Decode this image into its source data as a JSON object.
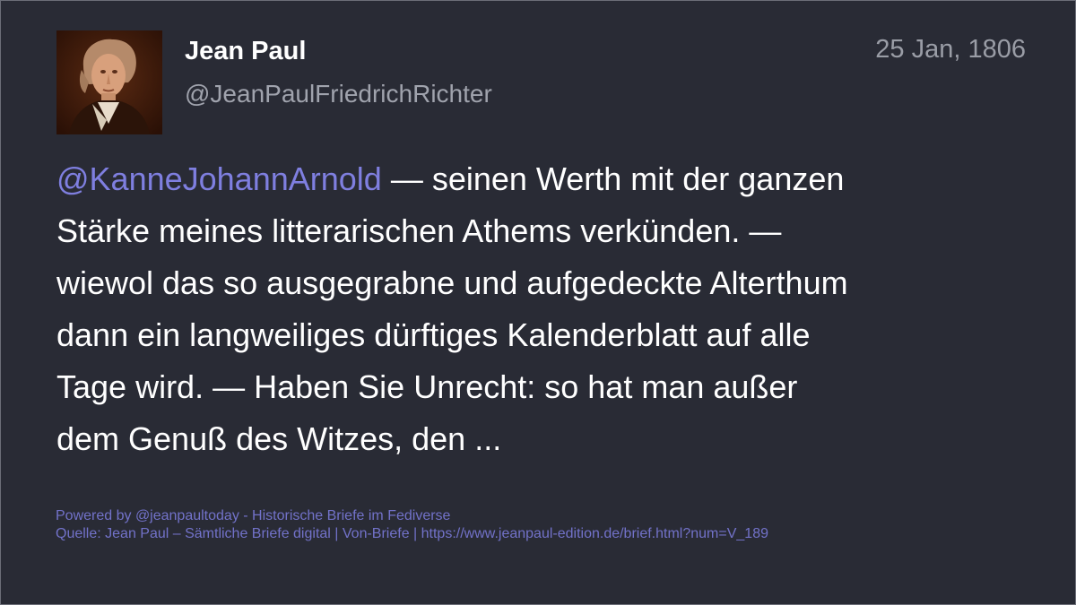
{
  "post": {
    "author_name": "Jean Paul",
    "author_handle": "@JeanPaulFriedrichRichter",
    "date": "25 Jan, 1806",
    "avatar_icon": "portrait-avatar",
    "mention": "@KanneJohannArnold",
    "lines": [
      " — seinen Werth mit der ganzen",
      "Stärke meines litterarischen Athems verkünden. —",
      "wiewol das so ausgegrabne und aufgedeckte Alterthum",
      "dann ein langweiliges dürftiges Kalenderblatt auf alle",
      "Tage wird. — Haben Sie Unrecht: so hat man außer",
      "dem Genuß des Witzes, den ..."
    ]
  },
  "footer": {
    "powered_by": "Powered by @jeanpaultoday - Historische Briefe im Fediverse",
    "source": "Quelle: Jean Paul – Sämtliche Briefe digital | Von-Briefe | https://www.jeanpaul-edition.de/brief.html?num=V_189"
  },
  "colors": {
    "background": "#292b35",
    "text": "#ffffff",
    "handle": "#a0a3ad",
    "mention": "#7f7fe0",
    "footer": "#7272c9"
  }
}
